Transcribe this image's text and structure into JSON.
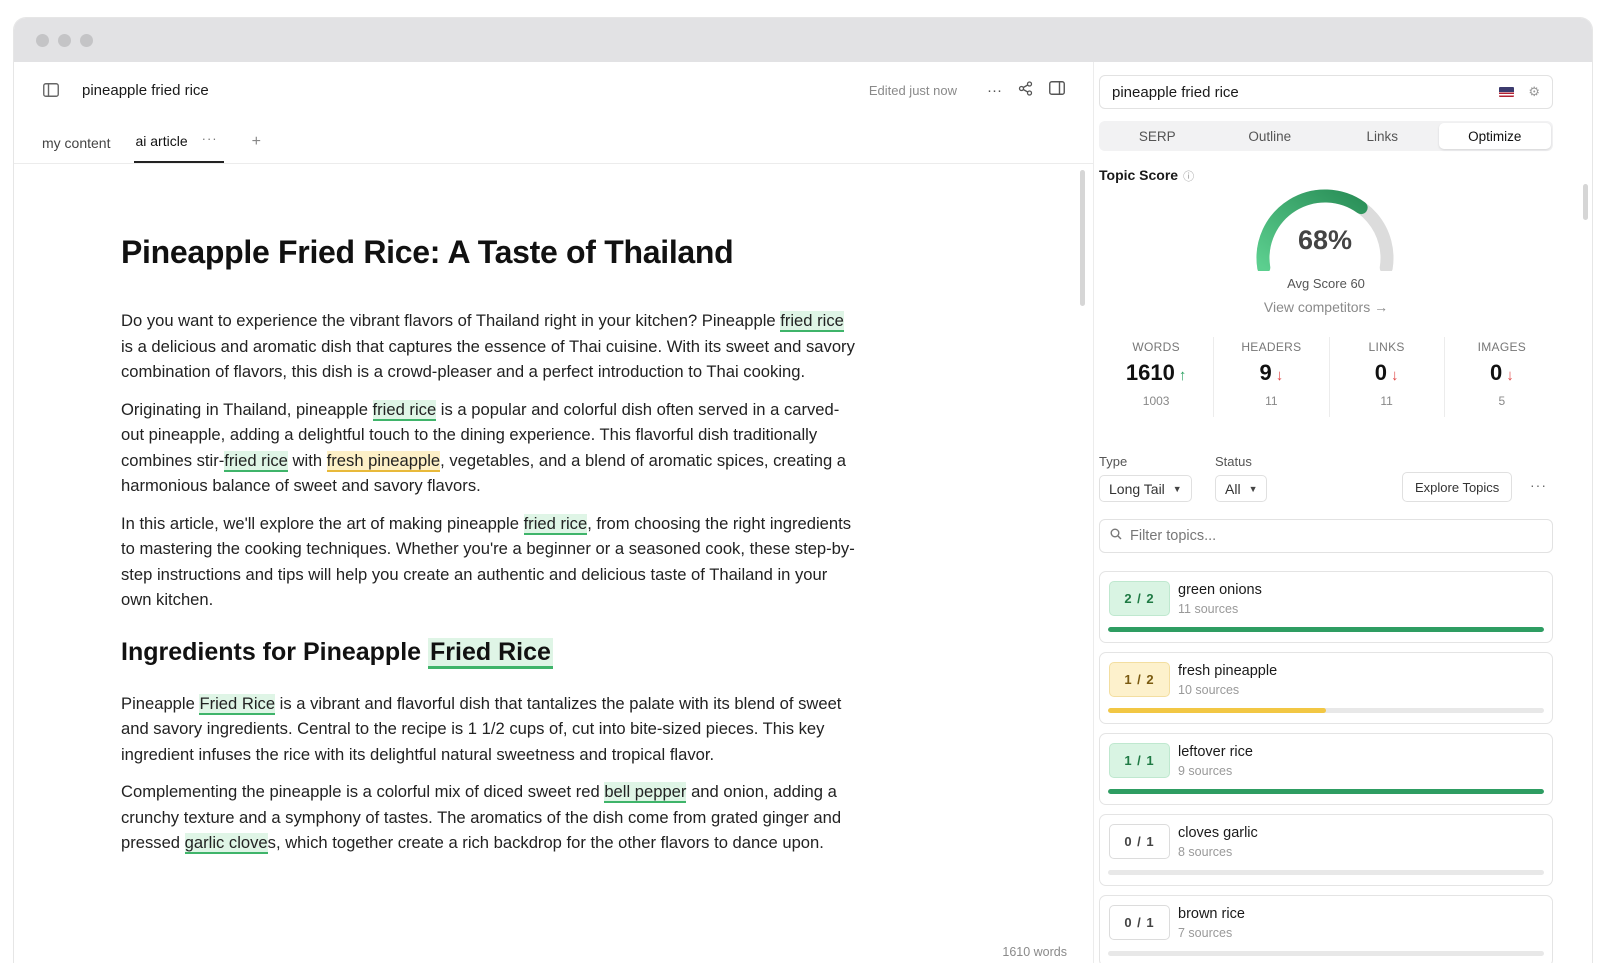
{
  "editor": {
    "doc_title": "pineapple fried rice",
    "edited_status": "Edited just now",
    "tabs": [
      {
        "label": "my content"
      },
      {
        "label": "ai article"
      }
    ],
    "word_count_label": "1610 words"
  },
  "article": {
    "h1": "Pineapple Fried Rice: A Taste of Thailand",
    "p1": {
      "a": "Do you want to experience the vibrant flavors of Thailand right in your kitchen? Pineapple ",
      "b": "fried rice",
      "c": " is a delicious and aromatic dish that captures the essence of Thai cuisine. With its sweet and savory combination of flavors, this dish is a crowd-pleaser and a perfect introduction to Thai cooking."
    },
    "p2": {
      "a": "Originating in Thailand, pineapple ",
      "b": "fried rice",
      "c": " is a popular and colorful dish often served in a carved-out pineapple, adding a delightful touch to the dining experience. This flavorful dish traditionally combines stir-",
      "d": "fried rice",
      "e": " with ",
      "f": "fresh pineapple",
      "g": ", vegetables, and a blend of aromatic spices, creating a harmonious balance of sweet and savory flavors."
    },
    "p3": {
      "a": "In this article, we'll explore the art of making pineapple ",
      "b": "fried rice",
      "c": ", from choosing the right ingredients to mastering the cooking techniques. Whether you're a beginner or a seasoned cook, these step-by-step instructions and tips will help you create an authentic and delicious taste of Thailand in your own kitchen."
    },
    "h2": {
      "a": "Ingredients for Pineapple ",
      "b": "Fried Rice"
    },
    "p4": {
      "a": "Pineapple ",
      "b": "Fried Rice",
      "c": " is a vibrant and flavorful dish that tantalizes the palate with its blend of sweet and savory ingredients. Central to the recipe is 1 1/2 cups of, cut into bite-sized pieces. This key ingredient infuses the rice with its delightful natural sweetness and tropical flavor."
    },
    "p5": {
      "a": "Complementing the pineapple is a colorful mix of diced sweet red ",
      "b": "bell pepper",
      "c": " and onion, adding a crunchy texture and a symphony of tastes. The aromatics of the dish come from grated ginger and pressed ",
      "d": "garlic clove",
      "e": "s, which together create a rich backdrop for the other flavors to dance upon."
    }
  },
  "panel": {
    "keyword": "pineapple fried rice",
    "tabs": [
      {
        "label": "SERP"
      },
      {
        "label": "Outline"
      },
      {
        "label": "Links"
      },
      {
        "label": "Optimize"
      }
    ],
    "active_tab": "Optimize",
    "topic_score_label": "Topic Score",
    "score": 68,
    "score_label": "68%",
    "avg_score_label": "Avg Score 60",
    "view_competitors_label": "View competitors",
    "stats": [
      {
        "label": "WORDS",
        "value": "1610",
        "trend": "up",
        "target": "1003"
      },
      {
        "label": "HEADERS",
        "value": "9",
        "trend": "down",
        "target": "11"
      },
      {
        "label": "LINKS",
        "value": "0",
        "trend": "down",
        "target": "11"
      },
      {
        "label": "IMAGES",
        "value": "0",
        "trend": "down",
        "target": "5"
      }
    ],
    "type_label": "Type",
    "type_value": "Long Tail",
    "status_label": "Status",
    "status_value": "All",
    "explore_label": "Explore Topics",
    "filter_placeholder": "Filter topics...",
    "topics": [
      {
        "count": "2 / 2",
        "name": "green onions",
        "sources": "11 sources",
        "progress": 1.0,
        "state": "full"
      },
      {
        "count": "1 / 2",
        "name": "fresh pineapple",
        "sources": "10 sources",
        "progress": 0.5,
        "state": "partial"
      },
      {
        "count": "1 / 1",
        "name": "leftover rice",
        "sources": "9 sources",
        "progress": 1.0,
        "state": "full"
      },
      {
        "count": "0 / 1",
        "name": "cloves garlic",
        "sources": "8 sources",
        "progress": 0,
        "state": "none"
      },
      {
        "count": "0 / 1",
        "name": "brown rice",
        "sources": "7 sources",
        "progress": 0,
        "state": "none"
      }
    ]
  },
  "colors": {
    "accent_green": "#2e9d62",
    "partial_yellow": "#f2c744",
    "gauge_track": "#dcdcdc"
  }
}
